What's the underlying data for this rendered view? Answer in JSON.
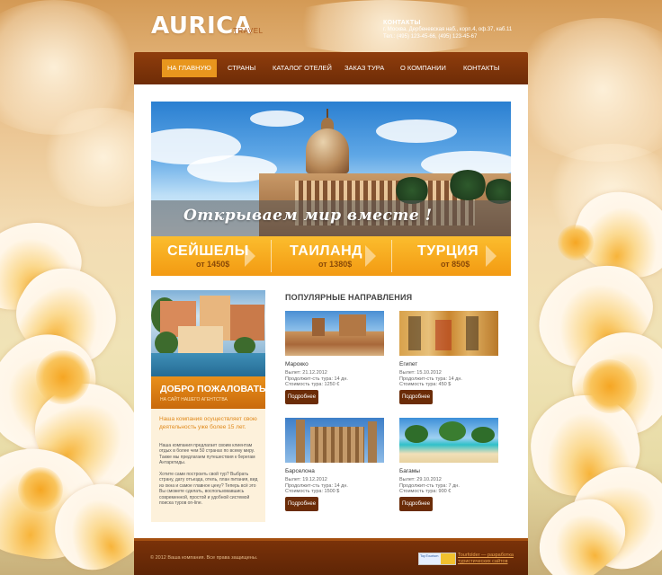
{
  "header": {
    "logo": "AURICA",
    "logo_sub": "TRAVEL",
    "contacts_title": "КОНТАКТЫ",
    "contacts_address": "г. Москва, Дербеневская наб., корп.4, оф.37, каб.11",
    "contacts_phone": "Тел.: (495) 123-45-66, (495) 123-45-67"
  },
  "nav": {
    "items": [
      {
        "label": "НА ГЛАВНУЮ",
        "active": true
      },
      {
        "label": "СТРАНЫ"
      },
      {
        "label": "КАТАЛОГ ОТЕЛЕЙ"
      },
      {
        "label": "ЗАКАЗ ТУРА"
      },
      {
        "label": "О КОМПАНИИ"
      },
      {
        "label": "КОНТАКТЫ"
      }
    ]
  },
  "hero": {
    "slogan": "Открываем мир вместе !"
  },
  "promo": [
    {
      "name": "СЕЙШЕЛЫ",
      "price": "от 1450$"
    },
    {
      "name": "ТАИЛАНД",
      "price": "от 1380$"
    },
    {
      "name": "ТУРЦИЯ",
      "price": "от 850$"
    }
  ],
  "sidebar": {
    "title": "ДОБРО ПОЖАЛОВАТЬ!",
    "subtitle": "НА САЙТ НАШЕГО АГЕНТСТВА",
    "lead": "Наша компания осуществляет свою деятельность уже более 15 лет.",
    "p1": "Наша компания предлагает своим клиентам отдых в более чем 50 странах по всему миру. Также мы предлагаем путешествия к берегам Антарктиды.",
    "p2": "Хотите сами построить свой тур? Выбрать страну, дату отъезда, отель, план питания, вид из окна и самое главное цену? Теперь всё это Вы сможете сделать, воспользовавшись современной, простой и удобной системой поиска туров on-line."
  },
  "destinations": {
    "section_title": "ПОПУЛЯРНЫЕ НАПРАВЛЕНИЯ",
    "items": [
      {
        "name": "Марокко",
        "date": "Вылет: 21.12.2012",
        "duration": "Продолжит-сть тура: 14 дн.",
        "price": "Стоимость тура: 1250 €",
        "button": "Подробнее"
      },
      {
        "name": "Египет",
        "date": "Вылет: 15.10.2012",
        "duration": "Продолжит-сть тура: 14 дн.",
        "price": "Стоимость тура: 450 $",
        "button": "Подробнее"
      },
      {
        "name": "Барселона",
        "date": "Вылет: 19.12.2012",
        "duration": "Продолжит-сть тура: 14 дн.",
        "price": "Стоимость тура: 1500 $",
        "button": "Подробнее"
      },
      {
        "name": "Багамы",
        "date": "Вылет: 29.10.2012",
        "duration": "Продолжит-сть тура: 7 дн.",
        "price": "Стоимость тура: 900 €",
        "button": "Подробнее"
      }
    ]
  },
  "footer": {
    "copyright": "© 2012  Ваша компания. Все права защищены.",
    "badge": "TopTourism",
    "link": "Tourfolder — разработка туристических сайтов"
  },
  "colors": {
    "nav_bg": "#7a3209",
    "nav_active": "#e8961e",
    "promo": "#f7a91f",
    "button": "#6b2c08",
    "accent_text": "#e0891a"
  }
}
